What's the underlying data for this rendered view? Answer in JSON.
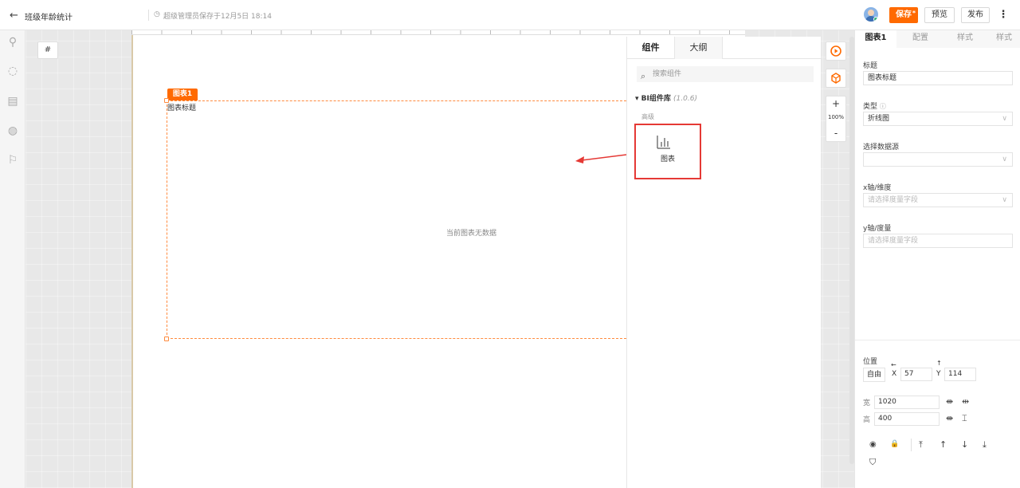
{
  "header": {
    "back_icon": "←",
    "title": "班级年龄统计",
    "clock_icon": "◷",
    "saved_info": "超级管理员保存于12月5日 18:14",
    "save_label": "保存",
    "save_marker": "*",
    "preview_label": "预览",
    "publish_label": "发布",
    "more_icon": "⋮"
  },
  "rail": {
    "icons": [
      "plug-icon",
      "palette-icon",
      "report-icon",
      "globe-icon",
      "flag-icon"
    ],
    "glyphs": [
      "⚲",
      "◌",
      "▤",
      "◍",
      "⚐"
    ]
  },
  "canvas": {
    "hash_label": "#",
    "chart_tag": "图表1",
    "chart_title": "图表标题",
    "no_data": "当前图表无数据"
  },
  "components": {
    "tabs": [
      "组件",
      "大纲"
    ],
    "search_icon": "⌕",
    "search_placeholder": "搜索组件",
    "library_caret": "▾",
    "library_name": "BI组件库",
    "library_version": "(1.0.6)",
    "group_label": "高级",
    "item_label": "图表"
  },
  "zoom": {
    "plus": "+",
    "level": "100%",
    "minus": "-"
  },
  "properties": {
    "tabs": [
      "图表1",
      "配置",
      "样式",
      "样式"
    ],
    "title_label": "标题",
    "title_value": "图表标题",
    "type_label": "类型",
    "type_info_icon": "ⓘ",
    "type_value": "折线图",
    "datasource_label": "选择数据源",
    "datasource_value": "",
    "xaxis_label": "x轴/维度",
    "xaxis_placeholder": "请选择度量字段",
    "yaxis_label": "y轴/度量",
    "yaxis_placeholder": "请选择度量字段",
    "chevron": "∨",
    "position_label": "位置",
    "position_mode": "自由",
    "x_label": "X",
    "x_value": "57",
    "y_label": "Y",
    "y_value": "114",
    "width_label": "宽",
    "width_value": "1020",
    "height_label": "高",
    "height_value": "400",
    "arrow_left": "←",
    "arrow_up": "↑",
    "fit_w_glyphs": [
      "⇼",
      "⇹"
    ],
    "fit_h_glyphs": [
      "⇼",
      "⌶"
    ],
    "layer_glyphs": [
      "◉",
      "🔒",
      "⤒",
      "↑",
      "↓",
      "⤓"
    ],
    "shield_glyph": "⛉"
  }
}
